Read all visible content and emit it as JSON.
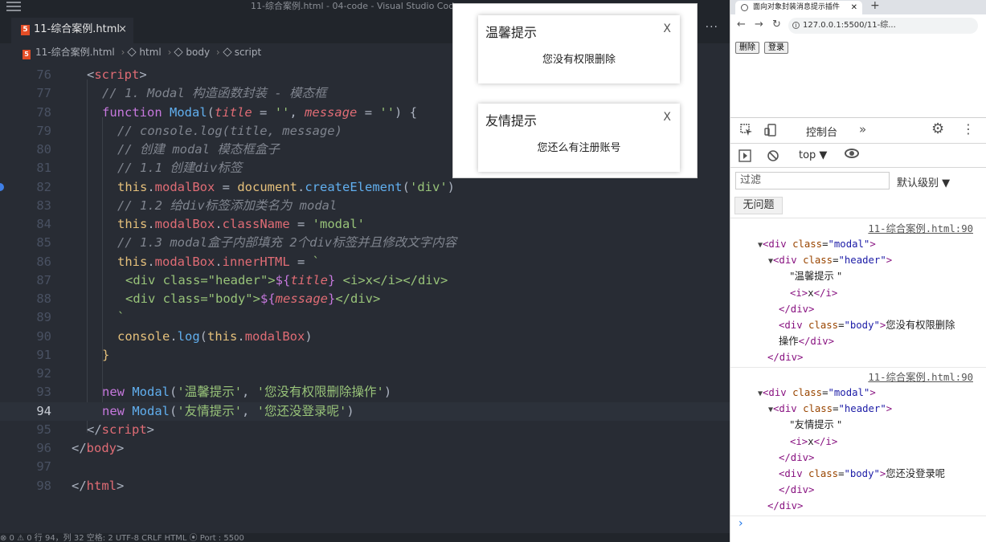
{
  "vscode": {
    "window_title": "11-综合案例.html - 04-code - Visual Studio Code",
    "tab_label": "11-综合案例.html",
    "tab_close": "×",
    "more": "···",
    "breadcrumb": {
      "file": "11-综合案例.html",
      "html": "html",
      "body": "body",
      "script": "script"
    },
    "statusbar": "⊗ 0    ⚠ 0                                                                                       行 94，列 32   空格: 2   UTF-8   CRLF   HTML   ⦿ Port : 5500",
    "line_numbers": [
      "76",
      "77",
      "78",
      "79",
      "80",
      "81",
      "82",
      "83",
      "84",
      "85",
      "86",
      "87",
      "88",
      "89",
      "90",
      "91",
      "92",
      "93",
      "94",
      "95",
      "96",
      "97",
      "98"
    ],
    "active_line": "94"
  },
  "page_modals": [
    {
      "title": "温馨提示",
      "close": "X",
      "body": "您没有权限删除"
    },
    {
      "title": "友情提示",
      "close": "X",
      "body": "您还么有注册账号"
    }
  ],
  "browser": {
    "tab_title": "面向对象封装消息提示插件",
    "tab_close": "✕",
    "new_tab": "+",
    "url": "127.0.0.1:5500/11-综...",
    "buttons": {
      "delete": "删除",
      "login": "登录"
    }
  },
  "devtools": {
    "console_tab": "控制台",
    "more_tabs": "»",
    "context": "top ▼",
    "filter_placeholder": "过滤",
    "level": "默认级别 ▼",
    "no_issues": "无问题",
    "log_source": "11-综合案例.html:90",
    "entries": [
      {
        "title_text": "\"温馨提示 \"",
        "body_text_1": "您没有权限删除",
        "body_text_2": "操作"
      },
      {
        "title_text": "\"友情提示 \"",
        "body_text_1": "您还没登录呢",
        "body_text_2": ""
      }
    ],
    "prompt": "›"
  },
  "colors": {
    "editor_bg": "#282c34",
    "accent_blue": "#3f7fe6",
    "html_icon": "#e44d26"
  }
}
